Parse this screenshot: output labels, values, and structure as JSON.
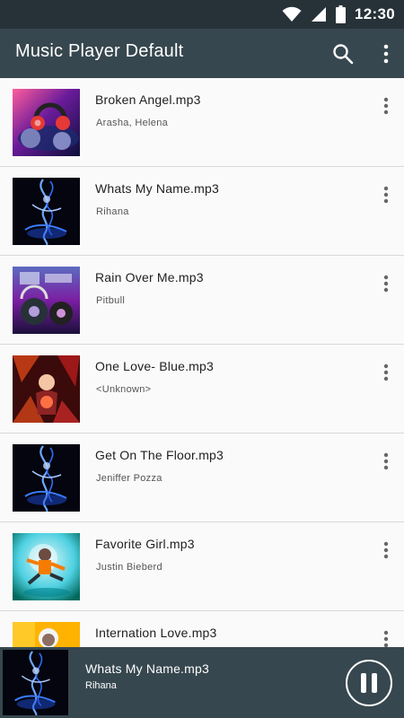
{
  "status_bar": {
    "time": "12:30",
    "icons": [
      "wifi-icon",
      "cell-signal-icon",
      "battery-icon"
    ]
  },
  "app_bar": {
    "title": "Music Player Default",
    "actions": [
      "search-icon",
      "more-vert-icon"
    ]
  },
  "songs": [
    {
      "title": "Broken Angel.mp3",
      "artist": "Arasha, Helena",
      "art": "dj-headphones-red"
    },
    {
      "title": "Whats My Name.mp3",
      "artist": "Rihana",
      "art": "neon-dancer-blue"
    },
    {
      "title": "Rain Over Me.mp3",
      "artist": "Pitbull",
      "art": "dj-mixer-purple"
    },
    {
      "title": "One Love- Blue.mp3",
      "artist": "<Unknown>",
      "art": "fantasy-red"
    },
    {
      "title": "Get On The Floor.mp3",
      "artist": "Jeniffer Pozza",
      "art": "neon-dancer-blue"
    },
    {
      "title": "Favorite Girl.mp3",
      "artist": "Justin Bieberd",
      "art": "breakdancer"
    },
    {
      "title": "Internation Love.mp3",
      "artist": "",
      "art": "yellow-portrait"
    }
  ],
  "now_playing": {
    "title": "Whats My Name.mp3",
    "artist": "Rihana",
    "art": "neon-dancer-blue",
    "state": "playing",
    "control_icon": "pause-icon"
  },
  "colors": {
    "status_bar": "#263238",
    "app_bar": "#37474f",
    "list_background": "#fafafa",
    "divider": "#d9d9d9",
    "now_playing_bar": "#37474f"
  }
}
